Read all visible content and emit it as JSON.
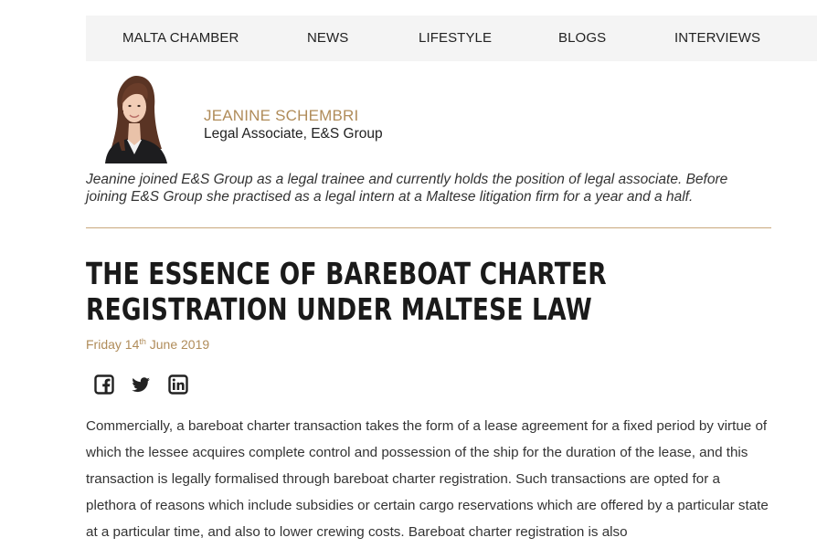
{
  "nav": {
    "items": [
      {
        "label": "MALTA CHAMBER"
      },
      {
        "label": "NEWS"
      },
      {
        "label": "LIFESTYLE"
      },
      {
        "label": "BLOGS"
      },
      {
        "label": "INTERVIEWS"
      }
    ]
  },
  "author": {
    "name": "JEANINE SCHEMBRI",
    "role": "Legal Associate, E&S Group",
    "bio": "Jeanine joined E&S Group as a legal trainee and currently holds the position of legal associate. Before joining E&S Group she practised as a legal intern at a Maltese litigation firm for a year and a half."
  },
  "article": {
    "title": "THE ESSENCE OF BAREBOAT CHARTER REGISTRATION UNDER MALTESE LAW",
    "date": {
      "prefix": "Friday 14",
      "suffix": "th",
      "rest": " June 2019"
    },
    "body": "Commercially, a bareboat charter transaction takes the form of a lease agreement for a fixed period by virtue of which the lessee acquires complete control and possession of the ship for the duration of the lease, and this transaction is legally formalised through bareboat charter registration. Such transactions are opted for a plethora of reasons which include subsidies or certain cargo reservations which are offered by a particular state at a particular time, and also to lower crewing costs.  Bareboat charter registration is also"
  },
  "share": {
    "icons": [
      "facebook-icon",
      "twitter-icon",
      "linkedin-icon"
    ]
  },
  "colors": {
    "accent": "#b08c5a",
    "nav_bg": "#f4f4f4",
    "divider": "#c9a77b",
    "text": "#333333"
  }
}
